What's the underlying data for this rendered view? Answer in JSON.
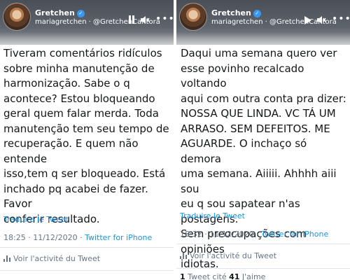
{
  "left": {
    "username": "Gretchen",
    "subtitle": "mariagretchen · @GretchenCantora",
    "tweet_text": "Tiveram comentários ridículos\nsobre minha manutenção de\nharmonização. Sabe o q\nacontece? Estou bloqueando\ngeral quem falar merda. Toda\nmanutenção tem seu tempo de\nrecuperação. E quem não entende\nisso,tem q ser bloqueado. Está\ninchado pq acabei de fazer. Favor\nconferir resultado.",
    "translate": "Traduire le Tweet",
    "time": "18:25 · 11/12/2020 · ",
    "source": "Twitter for iPhone",
    "activity": "Voir l'activité du Tweet"
  },
  "right": {
    "username": "Gretchen",
    "subtitle": "mariagretchen · @GretchenCantora",
    "tweet_text": "Daqui uma semana quero ver\nesse povinho recalcado voltando\naqui com outra conta pra dizer:\nNOSSA QUE LINDA. VC TÁ UM\nARRASO. SEM DEFEITOS. ME\nAGUARDE. O inchaço só demora\numa semana. Aiiiii. Ahhhh aiii sou\neu q sou sapatear n'as postagens.\nSem preocupações com opiniões\nidiotas.",
    "translate": "Traduire le Tweet",
    "time": "18:32 · 11/12/2020 · ",
    "source": "Twitter for iPhone",
    "activity": "Voir l'activité du Tweet",
    "stats_quote_count": "1",
    "stats_quote_label": "Tweet cité",
    "stats_like_count": "41",
    "stats_like_label": "J'aime"
  },
  "icons": {
    "verified": "verified-badge-icon",
    "pause": "pause-icon",
    "play": "play-icon",
    "mute": "speaker-mute-icon",
    "more": "more-dots-icon",
    "activity": "bar-chart-icon"
  },
  "colors": {
    "link": "#1b95e0",
    "text": "#14171a",
    "muted": "#657786",
    "verified": "#3897f0"
  }
}
